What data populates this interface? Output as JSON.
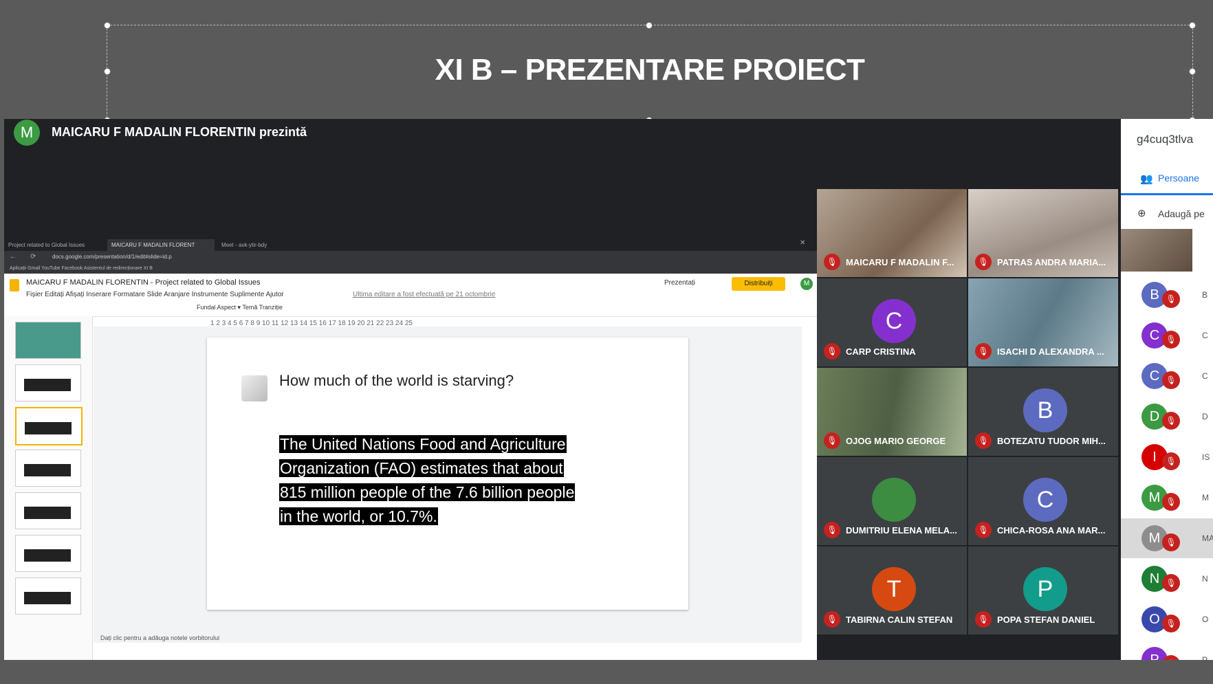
{
  "slide_title": "XI B – PREZENTARE PROIECT",
  "presenter": {
    "initial": "M",
    "label": "MAICARU F MADALIN FLORENTIN prezintă"
  },
  "browser": {
    "tabs": [
      "Project related to Global Issues",
      "MAICARU F MADALIN FLORENT",
      "Meet - avk-ytir-bdy"
    ],
    "url": "docs.google.com/presentation/d/1/edit#slide=id.p",
    "bookmarks": "Aplicații   Gmail   YouTube   Facebook   Asistentul de redirecționare   XI B",
    "doc_title": "MAICARU F MADALIN FLORENTIN - Project related to Global Issues",
    "menu": "Fișier   Editați   Afișați   Inserare   Formatare   Slide   Aranjare   Instrumente   Suplimente   Ajutor",
    "last_edit": "Ultima editare a fost efectuată pe 21 octombrie",
    "toolbar": "Fundal     Aspect ▾     Temă     Tranziție",
    "present_label": "Prezentați",
    "share_label": "Distribuiți",
    "user_initial": "M",
    "ruler": "1     2     3     4     5     6     7     8     9     10    11    12    13    14    15    16    17    18    19    20    21    22    23    24    25",
    "notes": "Dați clic pentru a adăuga notele vorbitorului"
  },
  "slide": {
    "question": "How much of the world is starving?",
    "body": "The United Nations Food and Agriculture Organization (FAO) estimates that about 815 million people of the 7.6 billion people in the world, or 10.7%."
  },
  "participants": [
    {
      "name": "MAICARU F MADALIN F...",
      "initial": "",
      "color": "",
      "photo": "photo1"
    },
    {
      "name": "PATRAS ANDRA MARIA...",
      "initial": "",
      "color": "",
      "photo": "photo2"
    },
    {
      "name": "CARP CRISTINA",
      "initial": "C",
      "color": "#8430ce",
      "photo": ""
    },
    {
      "name": "ISACHI D ALEXANDRA ...",
      "initial": "",
      "color": "",
      "photo": "photo3"
    },
    {
      "name": "OJOG MARIO GEORGE",
      "initial": "",
      "color": "",
      "photo": "photo4"
    },
    {
      "name": "BOTEZATU TUDOR MIH...",
      "initial": "B",
      "color": "#5c6bc0",
      "photo": ""
    },
    {
      "name": "DUMITRIU ELENA MELA...",
      "initial": "",
      "color": "#3c9a42",
      "photo": ""
    },
    {
      "name": "CHICA-ROSA ANA MAR...",
      "initial": "C",
      "color": "#5c6bc0",
      "photo": ""
    },
    {
      "name": "TABIRNA CALIN STEFAN",
      "initial": "T",
      "color": "#d64a11",
      "photo": ""
    },
    {
      "name": "POPA STEFAN DANIEL",
      "initial": "P",
      "color": "#129c8c",
      "photo": ""
    }
  ],
  "panel": {
    "meet_code": "g4cuq3tlva",
    "people_tab": "Persoane",
    "add_people": "Adaugă pe",
    "list": [
      {
        "initial": "B",
        "color": "#5c6bc0",
        "name": "B"
      },
      {
        "initial": "C",
        "color": "#8430ce",
        "name": "C"
      },
      {
        "initial": "C",
        "color": "#5c6bc0",
        "name": "C"
      },
      {
        "initial": "D",
        "color": "#3c9a42",
        "name": "D"
      },
      {
        "initial": "I",
        "color": "#d50000",
        "name": "IS"
      },
      {
        "initial": "M",
        "color": "#3c9a42",
        "name": "M"
      },
      {
        "initial": "M",
        "color": "#8d8d8d",
        "name": "MA"
      },
      {
        "initial": "N",
        "color": "#1e7e34",
        "name": "N"
      },
      {
        "initial": "O",
        "color": "#3949ab",
        "name": "O"
      },
      {
        "initial": "P",
        "color": "#8430ce",
        "name": "P"
      }
    ]
  }
}
